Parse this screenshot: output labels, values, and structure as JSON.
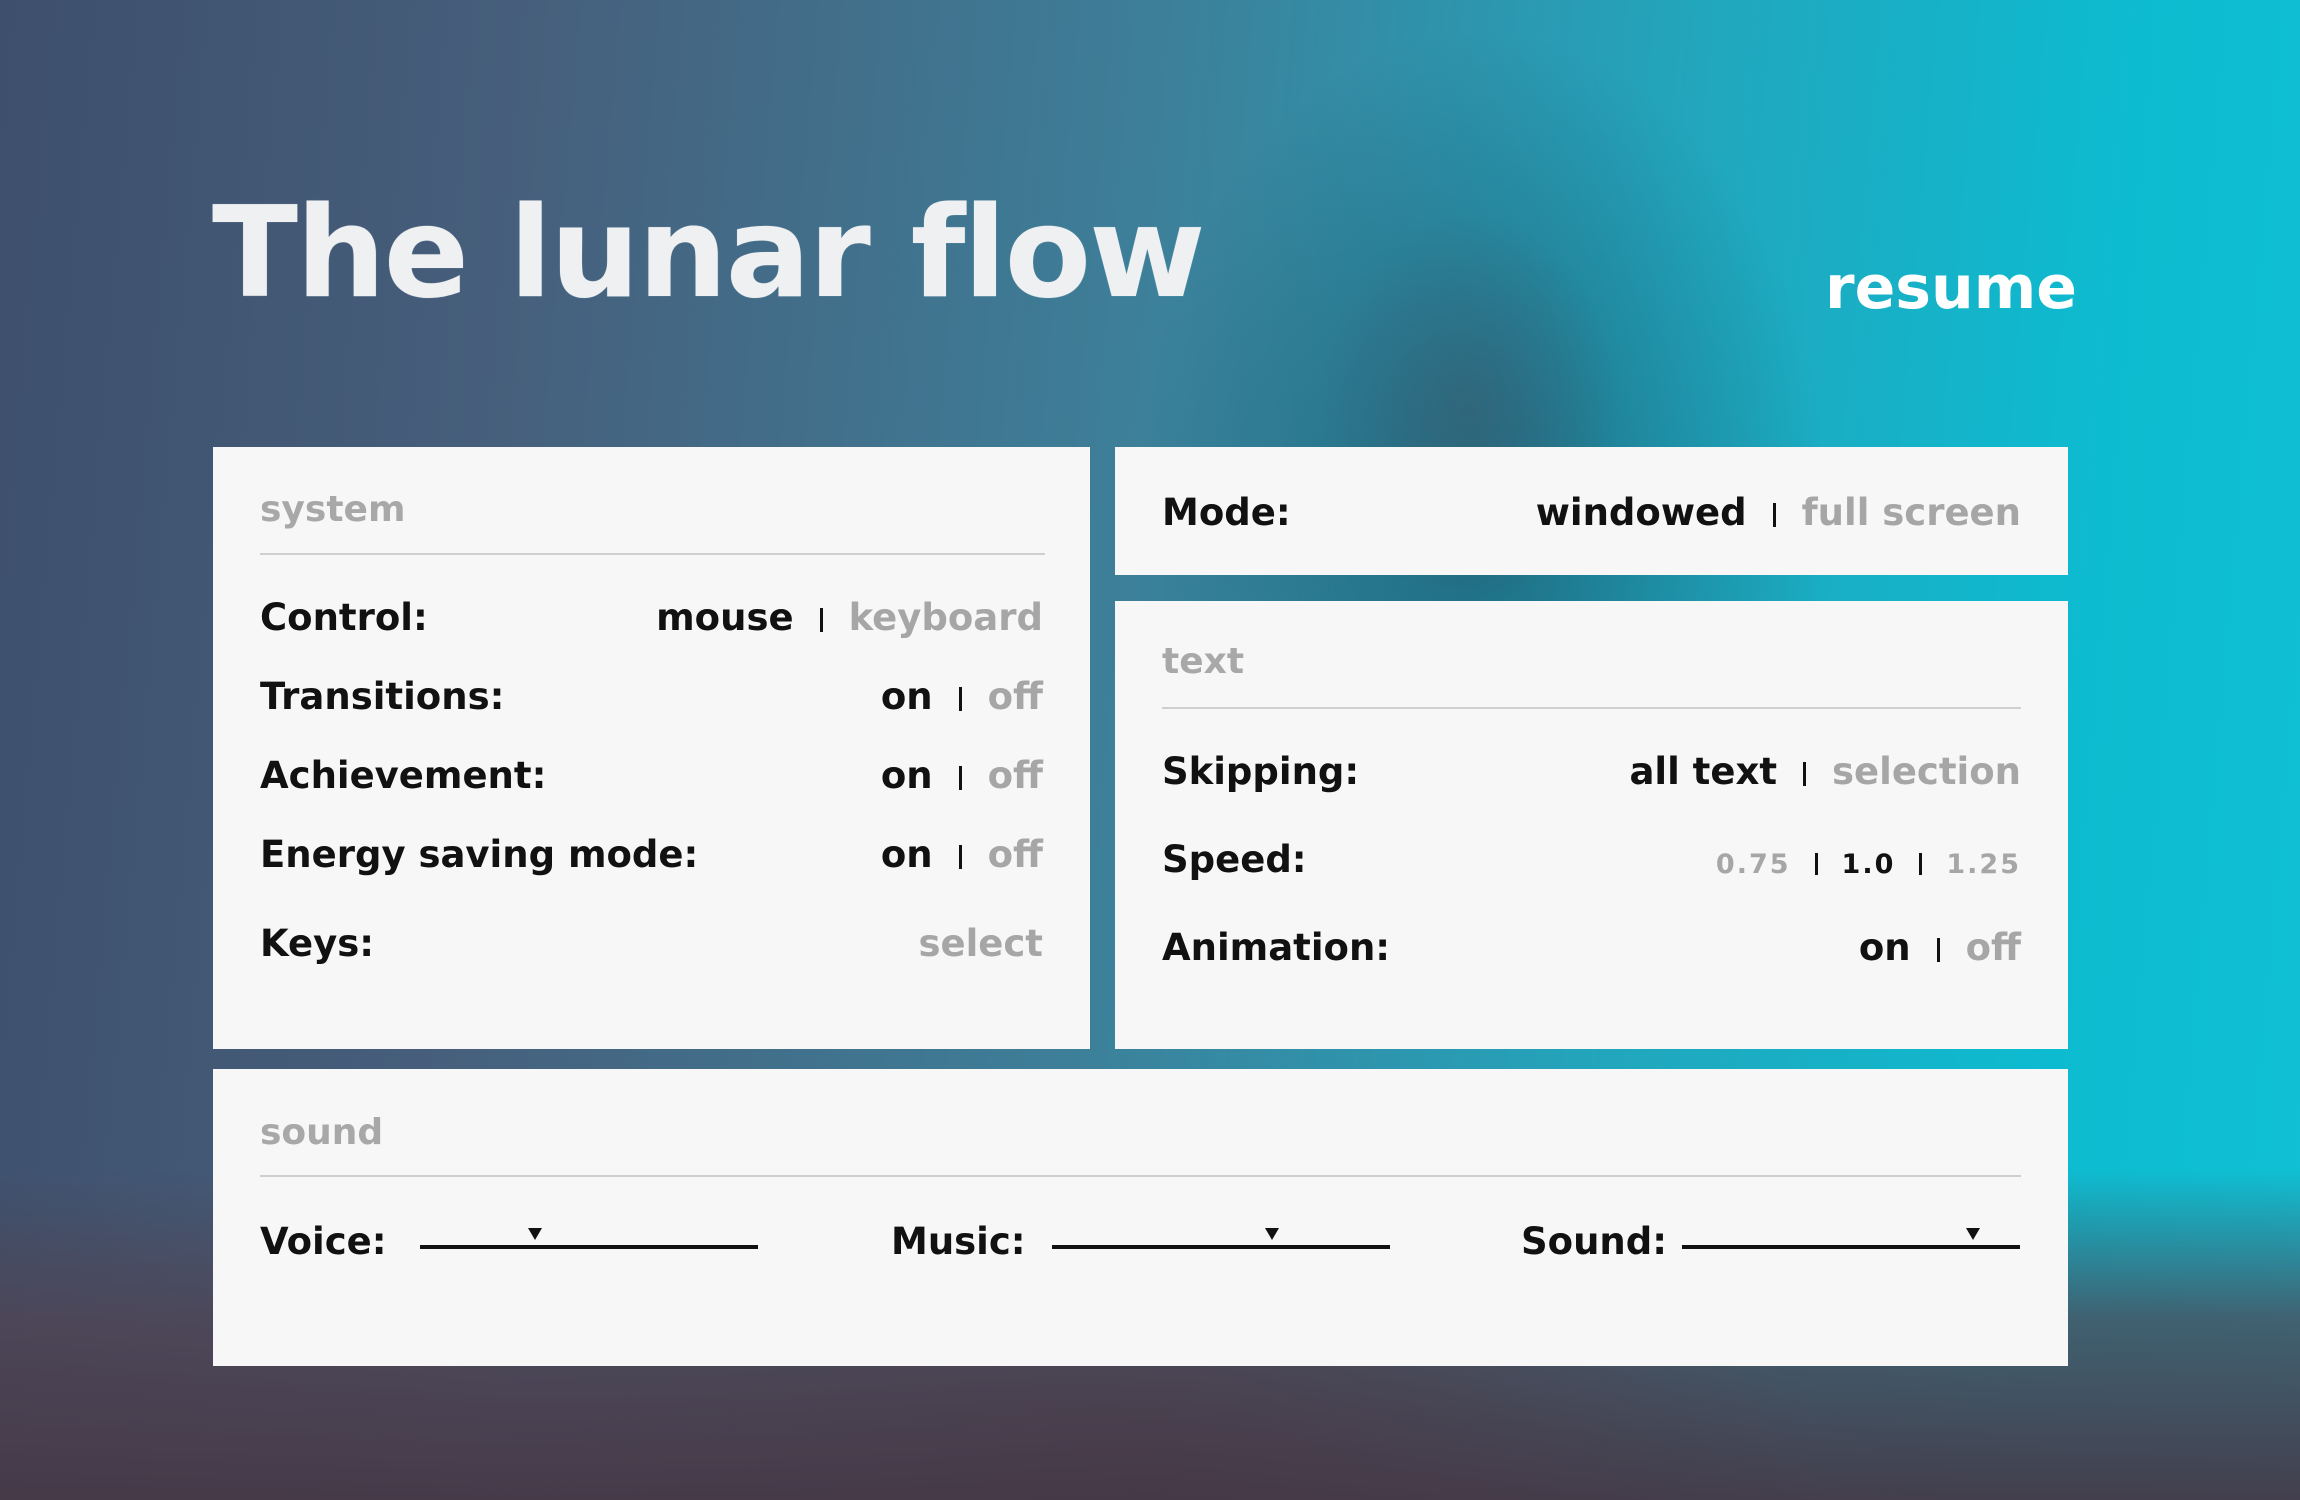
{
  "title": "The lunar flow",
  "resume_label": "resume",
  "system": {
    "title": "system",
    "rows": [
      {
        "label": "Control:",
        "options": [
          "mouse",
          "keyboard"
        ],
        "selected": "mouse"
      },
      {
        "label": "Transitions:",
        "options": [
          "on",
          "off"
        ],
        "selected": "on"
      },
      {
        "label": "Achievement:",
        "options": [
          "on",
          "off"
        ],
        "selected": "on"
      },
      {
        "label": "Energy saving mode:",
        "options": [
          "on",
          "off"
        ],
        "selected": "on"
      }
    ],
    "keys": {
      "label": "Keys:",
      "action": "select"
    }
  },
  "mode": {
    "label": "Mode:",
    "options": [
      "windowed",
      "full screen"
    ],
    "selected": "windowed"
  },
  "text": {
    "title": "text",
    "skipping": {
      "label": "Skipping:",
      "options": [
        "all text",
        "selection"
      ],
      "selected": "all text"
    },
    "speed": {
      "label": "Speed:",
      "options": [
        "0.75",
        "1.0",
        "1.25"
      ],
      "selected": "1.0"
    },
    "animation": {
      "label": "Animation:",
      "options": [
        "on",
        "off"
      ],
      "selected": "on"
    }
  },
  "sound": {
    "title": "sound",
    "voice": {
      "label": "Voice:",
      "level": 0.34
    },
    "music": {
      "label": "Music:",
      "level": 0.65
    },
    "sound": {
      "label": "Sound:",
      "level": 0.86
    }
  }
}
